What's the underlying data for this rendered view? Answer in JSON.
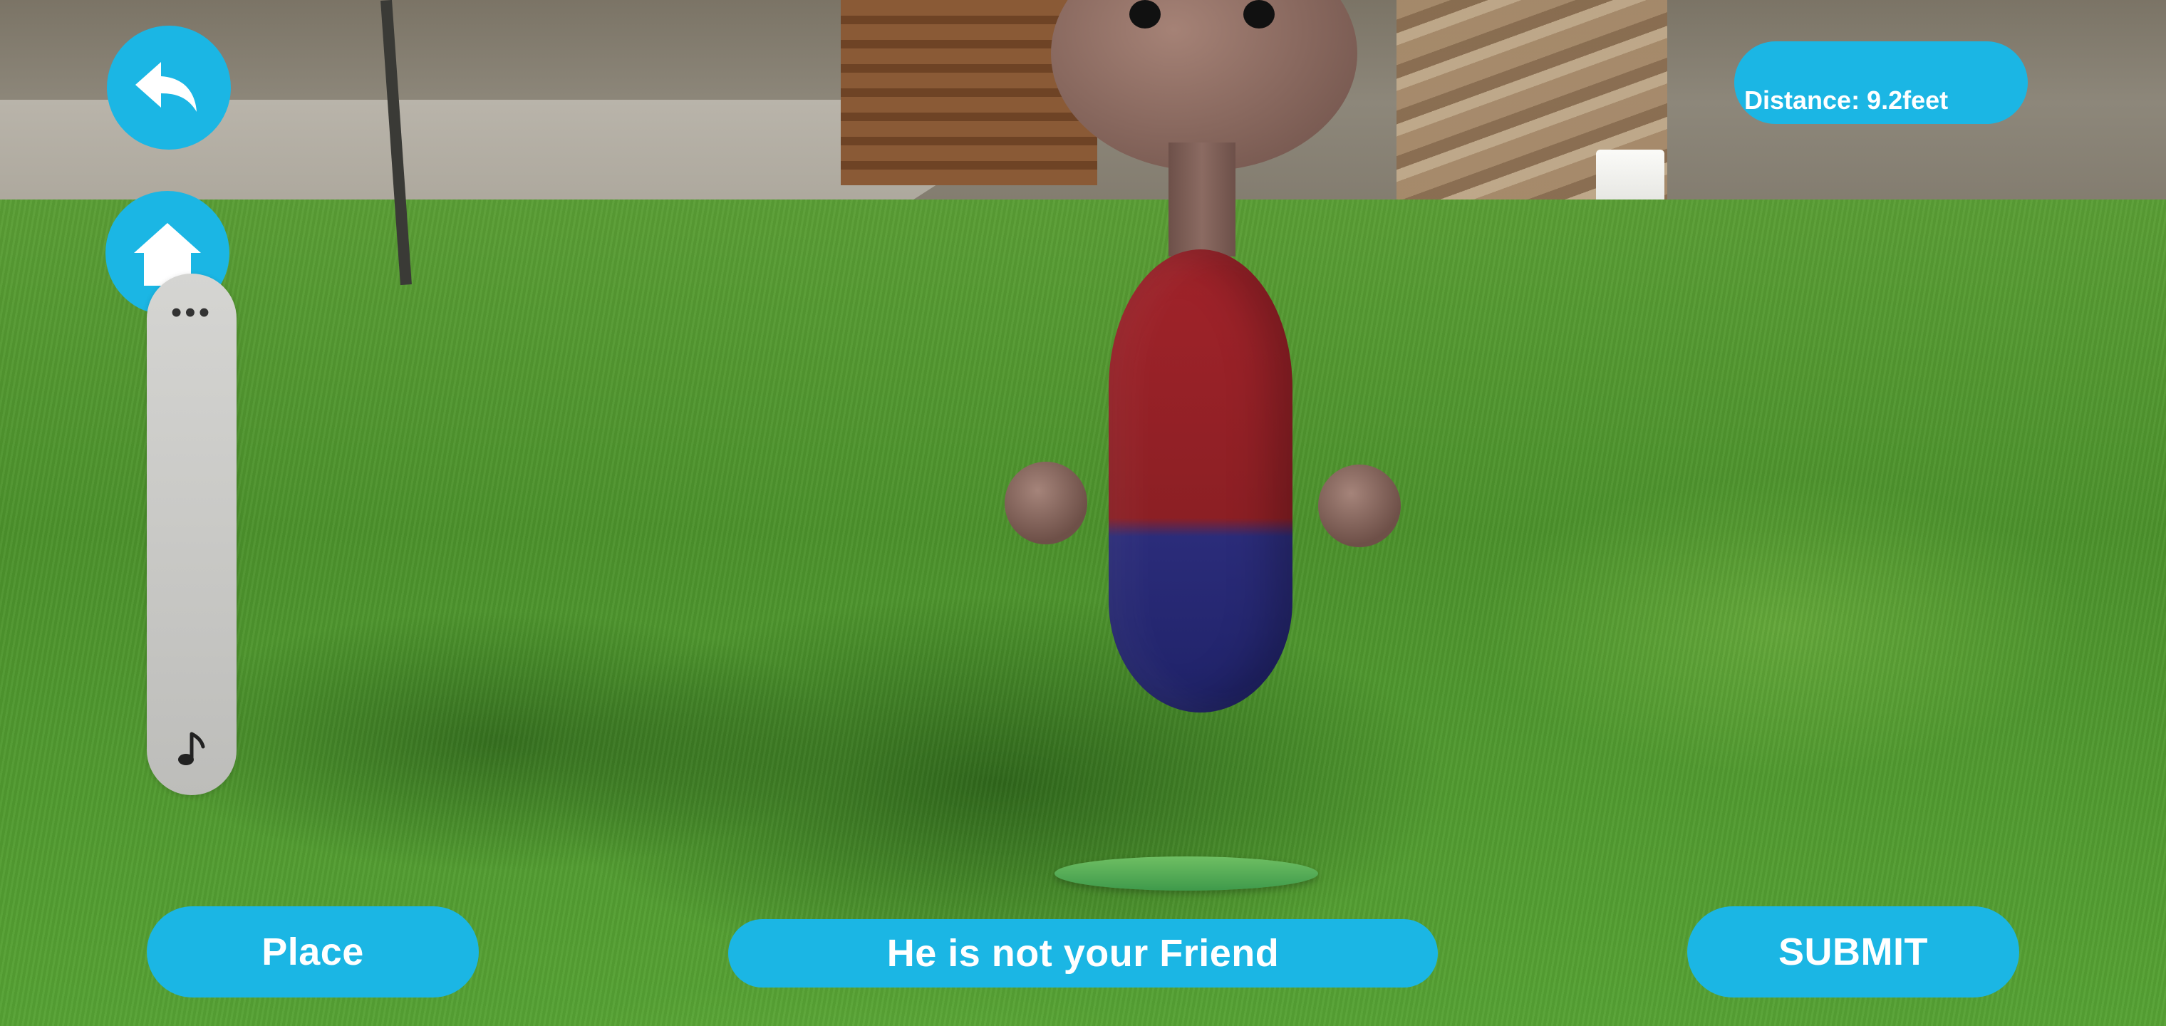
{
  "ar_view": {
    "character_colors": {
      "head": "#7d5e55",
      "shirt": "#8c1f24",
      "pants": "#1f2268",
      "base": "#4fae57"
    }
  },
  "toolbar": {
    "back_icon": "undo-arrow-icon",
    "home_icon": "home-icon"
  },
  "side_panel": {
    "more_label": "•••",
    "music_icon": "music-note-icon"
  },
  "distance": {
    "text": "Distance: 9.2feet"
  },
  "bottom_bar": {
    "place_label": "Place",
    "message_label": "He is not your Friend",
    "submit_label": "SUBMIT"
  },
  "theme": {
    "accent": "#1bb6e4",
    "panel": "#cfcfcc"
  }
}
